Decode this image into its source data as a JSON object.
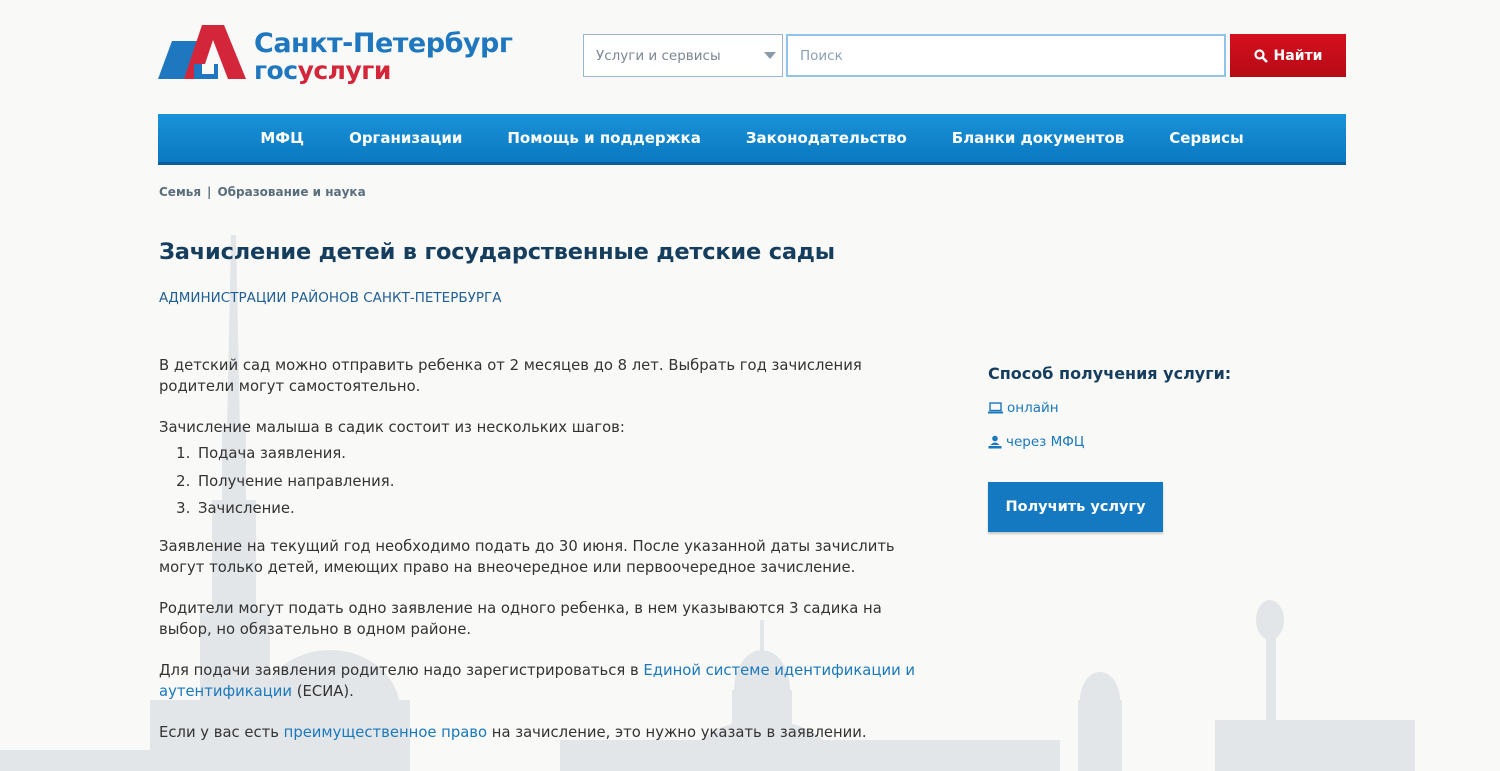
{
  "header": {
    "logo_line1": "Санкт-Петербург",
    "logo_gos": "гос",
    "logo_uslugi": "услуги",
    "select_label": "Услуги и сервисы",
    "search_placeholder": "Поиск",
    "find_label": "Найти"
  },
  "nav": {
    "items": [
      "МФЦ",
      "Организации",
      "Помощь и поддержка",
      "Законодательство",
      "Бланки документов",
      "Сервисы"
    ]
  },
  "breadcrumb": {
    "items": [
      "Семья",
      "Образование и наука"
    ],
    "separator": "|"
  },
  "page": {
    "title": "Зачисление детей в государственные детские сады",
    "organization": "АДМИНИСТРАЦИИ РАЙОНОВ САНКТ-ПЕТЕРБУРГА"
  },
  "content": {
    "p1": "В детский сад можно отправить ребенка от 2 месяцев до 8 лет. Выбрать год зачисления родители могут самостоятельно.",
    "p2": "Зачисление малыша в садик состоит из нескольких шагов:",
    "steps": [
      "Подача заявления.",
      "Получение направления.",
      "Зачисление."
    ],
    "p3": "Заявление на текущий год необходимо подать до 30 июня. После указанной даты зачислить могут только детей, имеющих право на внеочередное или первоочередное зачисление.",
    "p4": "Родители могут подать одно заявление на одного ребенка, в нем указываются 3 садика на выбор, но обязательно в одном районе.",
    "p5_before": "Для подачи заявления родителю надо зарегистрироваться в ",
    "p5_link": "Единой системе идентификации и аутентификации",
    "p5_after": " (ЕСИА).",
    "p6_before": "Если у вас есть ",
    "p6_link": "преимущественное право",
    "p6_after": " на зачисление, это нужно указать в заявлении."
  },
  "sidebar": {
    "heading": "Способ получения услуги:",
    "online_label": "онлайн",
    "mfc_label": "через МФЦ",
    "get_service_label": "Получить услугу"
  },
  "colors": {
    "brand_blue": "#1f78bf",
    "brand_red": "#d3263a",
    "nav_blue": "#0f86cc",
    "find_red": "#c70e1a",
    "title_navy": "#153e5e",
    "link_blue": "#1a78bd"
  }
}
